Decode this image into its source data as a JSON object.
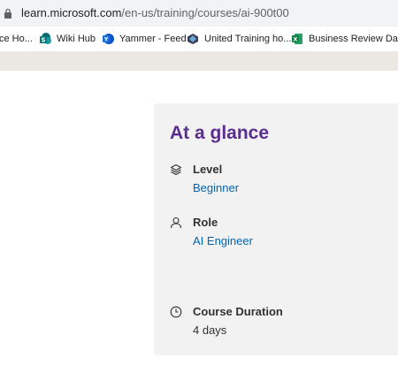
{
  "browser": {
    "url_host": "learn.microsoft.com",
    "url_path": "/en-us/training/courses/ai-900t00",
    "bookmarks": [
      {
        "label": "ce Ho...",
        "icon": "partial-bookmark"
      },
      {
        "label": "Wiki Hub",
        "icon": "sharepoint-icon"
      },
      {
        "label": "Yammer - Feed",
        "icon": "yammer-icon"
      },
      {
        "label": "United Training ho...",
        "icon": "united-training-icon"
      },
      {
        "label": "Business Review Da...",
        "icon": "excel-icon"
      }
    ]
  },
  "glance": {
    "title": "At a glance",
    "level": {
      "label": "Level",
      "value": "Beginner",
      "icon": "layers-icon"
    },
    "role": {
      "label": "Role",
      "value": "AI Engineer",
      "icon": "person-icon"
    },
    "duration": {
      "label": "Course Duration",
      "value": "4 days",
      "icon": "clock-icon"
    }
  },
  "colors": {
    "title": "#5c2d91",
    "link": "#0065b3",
    "card_bg": "#f2f2f2"
  }
}
